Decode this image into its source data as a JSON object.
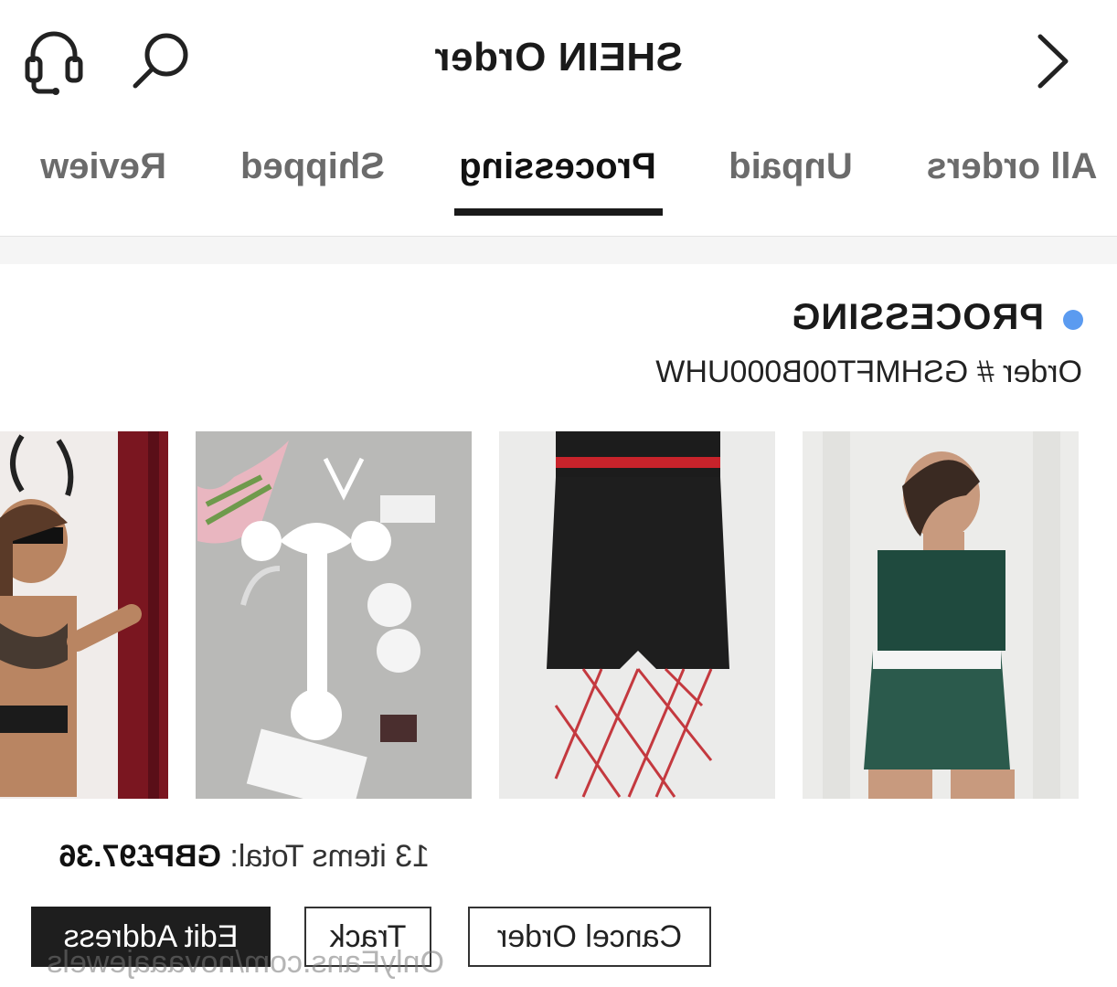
{
  "header": {
    "title": "SHEIN Order",
    "back_icon": "chevron-left-icon",
    "search_icon": "search-icon",
    "support_icon": "headset-icon"
  },
  "tabs": [
    {
      "label": "All orders",
      "active": false
    },
    {
      "label": "Unpaid",
      "active": false
    },
    {
      "label": "Processing",
      "active": true
    },
    {
      "label": "Shipped",
      "active": false
    },
    {
      "label": "Review",
      "active": false
    }
  ],
  "order": {
    "status": "PROCESSING",
    "status_color": "#5b9bf0",
    "order_label": "Order #",
    "order_number": "GSHMFT00B000UHW",
    "items_label": "13 items Total:",
    "total": "GBP£97.36"
  },
  "products": [
    {
      "name": "green crop top and shorts set"
    },
    {
      "name": "black denim shorts with red fishnet"
    },
    {
      "name": "white bunny costume set"
    },
    {
      "name": "black bunny lingerie set"
    }
  ],
  "actions": {
    "cancel": "Cancel Order",
    "track": "Track",
    "edit": "Edit Address"
  },
  "watermark": "OnlyFans.com/novaaajewels",
  "colors": {
    "active_tab_underline": "#1a1a1a",
    "primary_button": "#1e1e1e"
  }
}
